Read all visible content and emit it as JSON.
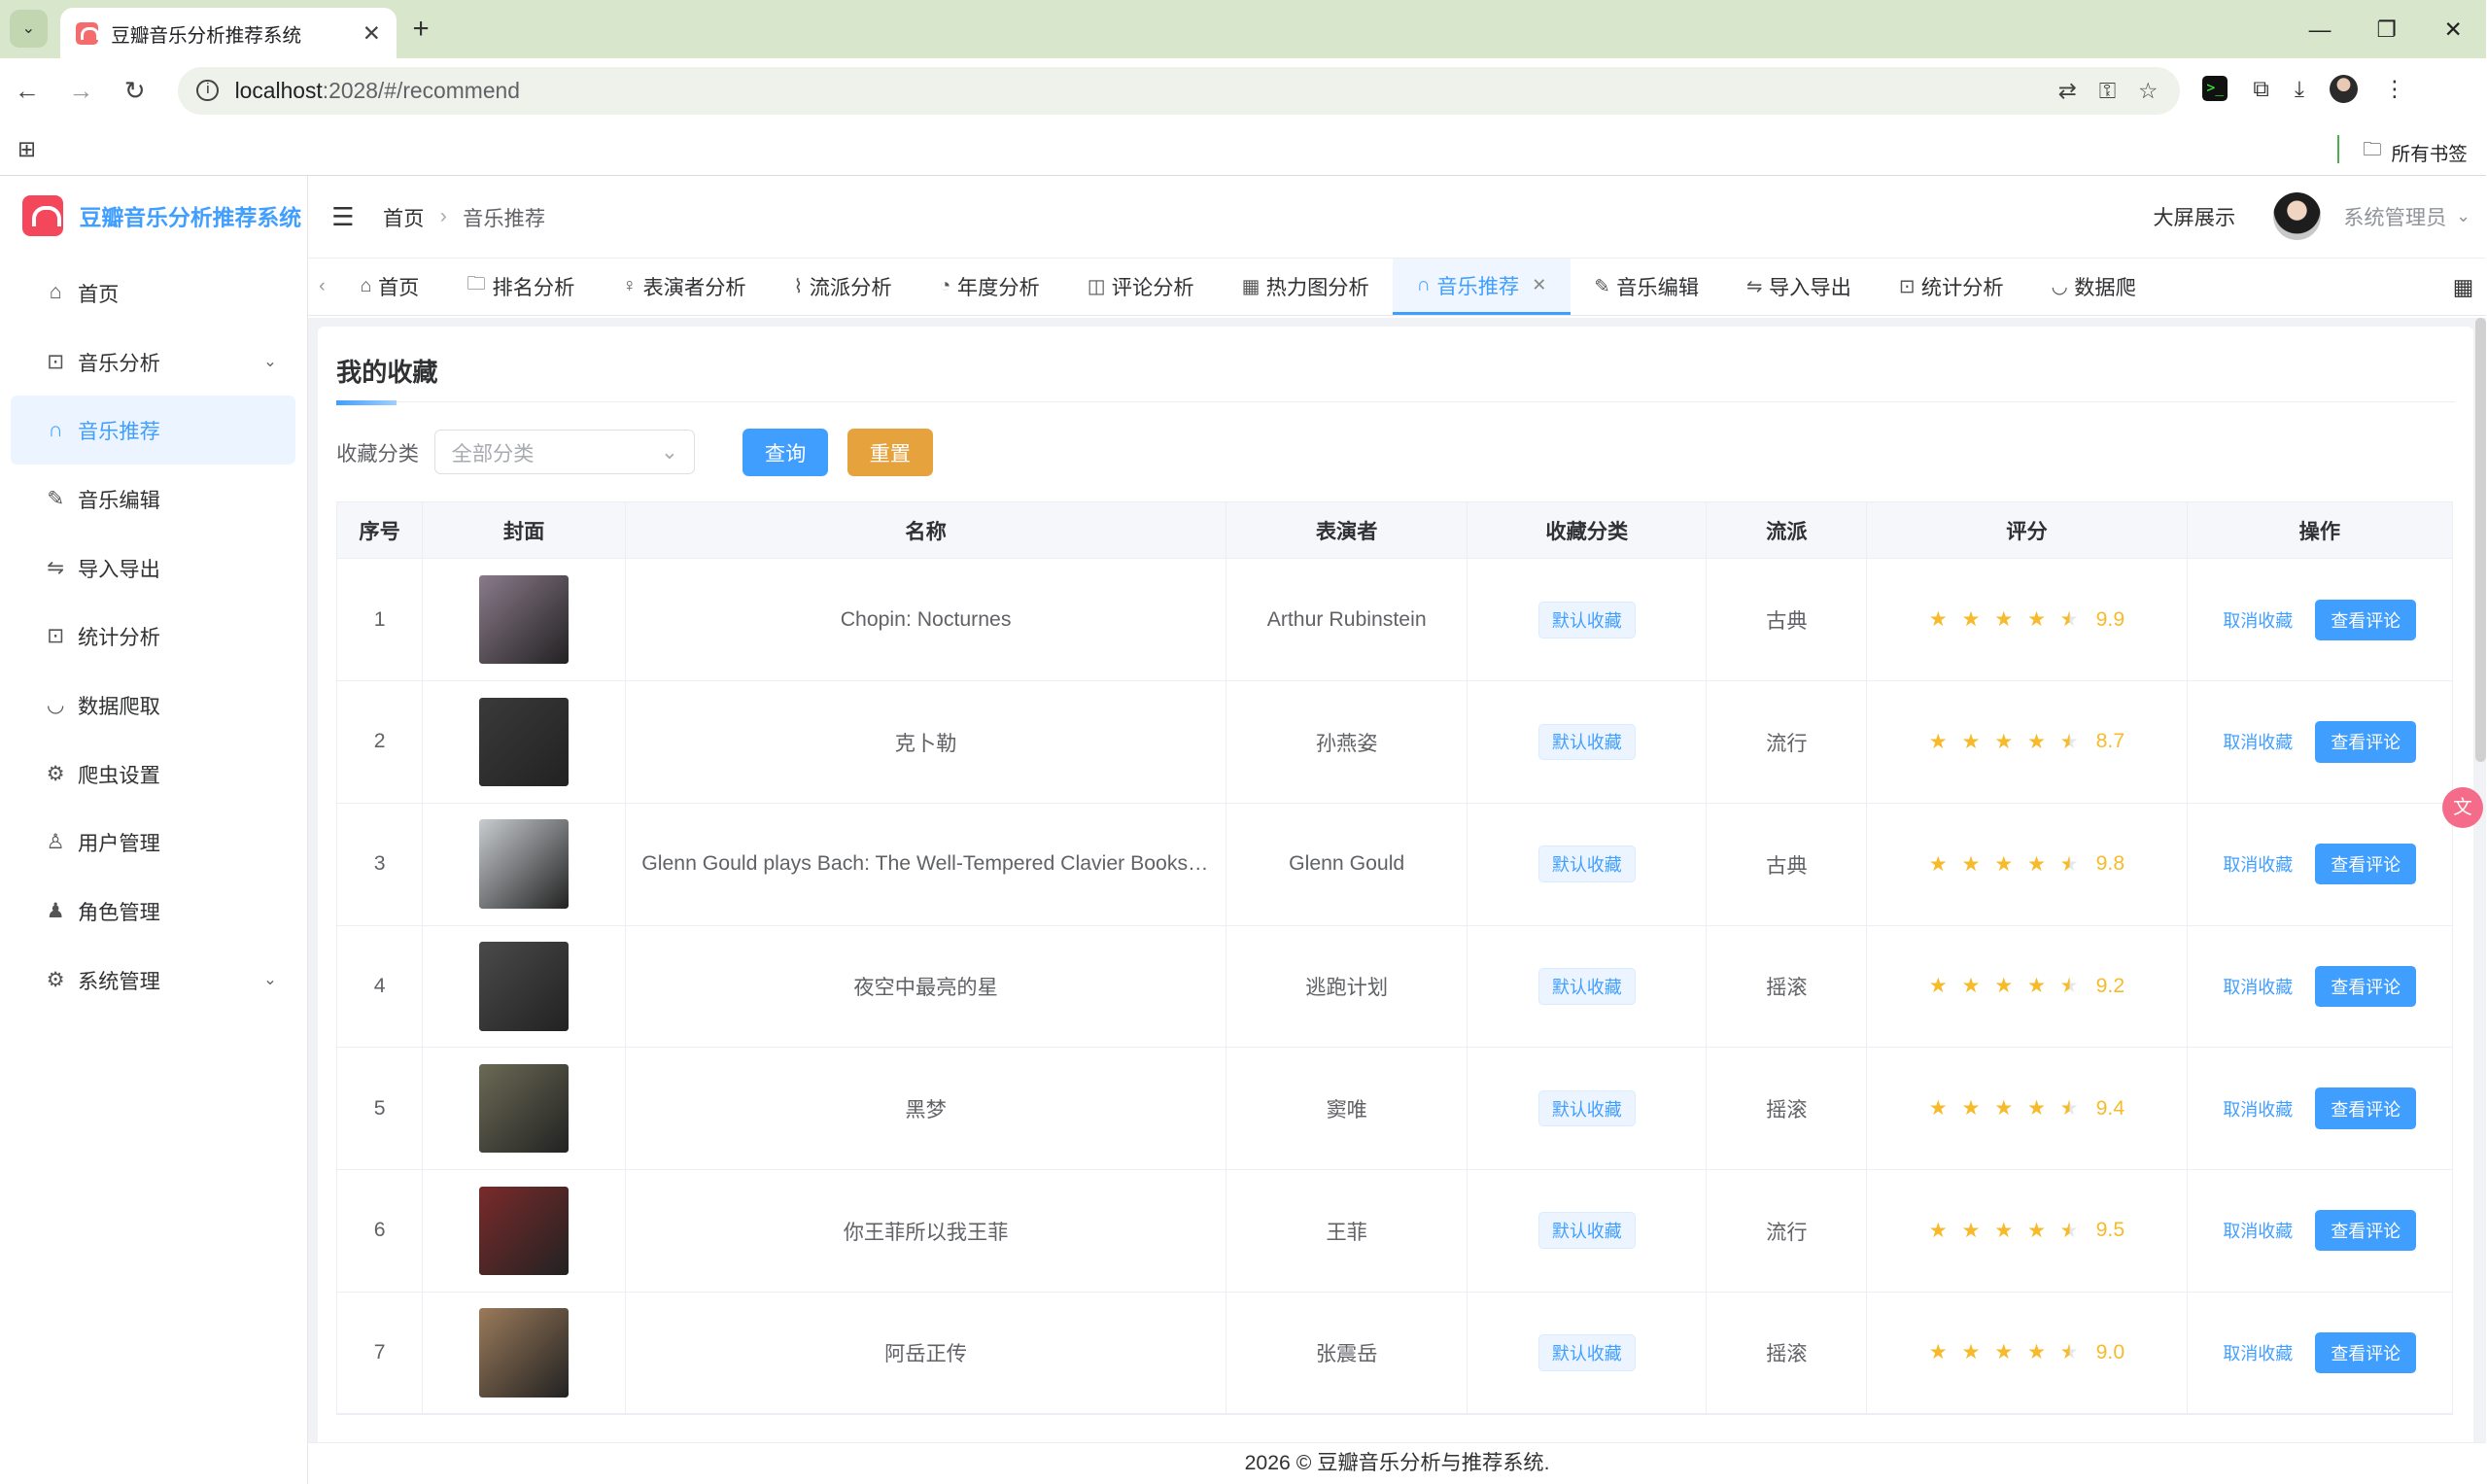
{
  "browser": {
    "tab_title": "豆瓣音乐分析推荐系统",
    "url_host": "localhost",
    "url_rest": ":2028/#/recommend",
    "bookmarks_label": "所有书签"
  },
  "app": {
    "title": "豆瓣音乐分析推荐系统",
    "breadcrumb": [
      "首页",
      "音乐推荐"
    ],
    "bigscreen_label": "大屏展示",
    "username": "系统管理员",
    "footer": "2026 © 豆瓣音乐分析与推荐系统."
  },
  "sidebar": {
    "items": [
      {
        "label": "首页",
        "icon": "home-icon"
      },
      {
        "label": "音乐分析",
        "icon": "presentation-icon"
      },
      {
        "label": "音乐推荐",
        "icon": "headphones-icon"
      },
      {
        "label": "音乐编辑",
        "icon": "edit-icon"
      },
      {
        "label": "导入导出",
        "icon": "transfer-icon"
      },
      {
        "label": "统计分析",
        "icon": "presentation-icon"
      },
      {
        "label": "数据爬取",
        "icon": "bowl-icon"
      },
      {
        "label": "爬虫设置",
        "icon": "gear-icon"
      },
      {
        "label": "用户管理",
        "icon": "user-icon"
      },
      {
        "label": "角色管理",
        "icon": "user-filled-icon"
      },
      {
        "label": "系统管理",
        "icon": "gear-icon"
      }
    ]
  },
  "tabs": [
    "首页",
    "排名分析",
    "表演者分析",
    "流派分析",
    "年度分析",
    "评论分析",
    "热力图分析",
    "音乐推荐",
    "音乐编辑",
    "导入导出",
    "统计分析",
    "数据爬"
  ],
  "page": {
    "title": "我的收藏",
    "filter_label": "收藏分类",
    "filter_placeholder": "全部分类",
    "query_btn": "查询",
    "reset_btn": "重置"
  },
  "table": {
    "headers": [
      "序号",
      "封面",
      "名称",
      "表演者",
      "收藏分类",
      "流派",
      "评分",
      "操作"
    ],
    "cancel_label": "取消收藏",
    "view_label": "查看评论",
    "rows": [
      {
        "no": "1",
        "name": "Chopin: Nocturnes",
        "artist": "Arthur Rubinstein",
        "category": "默认收藏",
        "genre": "古典",
        "rating": 9.9,
        "score": "9.9",
        "cover": "#8a7a8a"
      },
      {
        "no": "2",
        "name": "克卜勒",
        "artist": "孙燕姿",
        "category": "默认收藏",
        "genre": "流行",
        "rating": 8.7,
        "score": "8.7",
        "cover": "#3a3a3a"
      },
      {
        "no": "3",
        "name": "Glenn Gould plays Bach: The Well-Tempered Clavier Books I & II",
        "artist": "Glenn Gould",
        "category": "默认收藏",
        "genre": "古典",
        "rating": 9.8,
        "score": "9.8",
        "cover": "#c8ccd0"
      },
      {
        "no": "4",
        "name": "夜空中最亮的星",
        "artist": "逃跑计划",
        "category": "默认收藏",
        "genre": "摇滚",
        "rating": 9.2,
        "score": "9.2",
        "cover": "#4a4a4a"
      },
      {
        "no": "5",
        "name": "黑梦",
        "artist": "窦唯",
        "category": "默认收藏",
        "genre": "摇滚",
        "rating": 9.4,
        "score": "9.4",
        "cover": "#6b6a55"
      },
      {
        "no": "6",
        "name": "你王菲所以我王菲",
        "artist": "王菲",
        "category": "默认收藏",
        "genre": "流行",
        "rating": 9.5,
        "score": "9.5",
        "cover": "#7a2a2a"
      },
      {
        "no": "7",
        "name": "阿岳正传",
        "artist": "张震岳",
        "category": "默认收藏",
        "genre": "摇滚",
        "rating": 9.0,
        "score": "9.0",
        "cover": "#9a7a5a"
      }
    ]
  },
  "colors": {
    "primary": "#409eff",
    "warning": "#e6a23c",
    "star": "#f7ba2a"
  }
}
